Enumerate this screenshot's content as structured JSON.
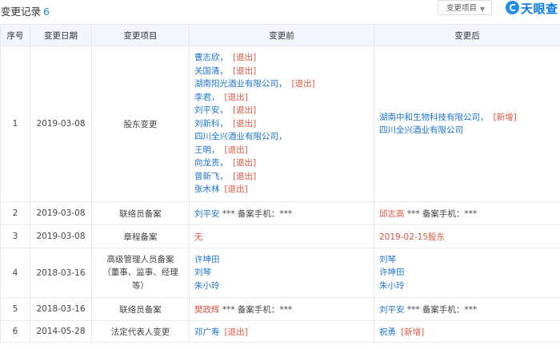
{
  "header": {
    "title": "变更记录",
    "count": "6",
    "filter_label": "变更项目",
    "filter_caret": "▼",
    "logo_text": "天眼查"
  },
  "columns": [
    "序号",
    "变更日期",
    "变更项目",
    "变更前",
    "变更后"
  ],
  "rows": [
    {
      "index": "1",
      "date": "2019-03-08",
      "item": "股东变更",
      "before": [
        {
          "text": "曹志欣，",
          "tag": "[退出]"
        },
        {
          "text": "关国清，",
          "tag": "[退出]"
        },
        {
          "text": "湖南阳光酒业有限公司，",
          "tag": "[退出]"
        },
        {
          "text": "李君，",
          "tag": "[退出]"
        },
        {
          "text": "刘平安，",
          "tag": "[退出]"
        },
        {
          "text": "刘新科，",
          "tag": "[退出]"
        },
        {
          "text": "四川全兴酒业有限公司，",
          "tag": ""
        },
        {
          "text": "王明，",
          "tag": "[退出]"
        },
        {
          "text": "向龙贵，",
          "tag": "[退出]"
        },
        {
          "text": "曾新飞，",
          "tag": "[退出]"
        },
        {
          "text": "张木林",
          "tag": "[退出]"
        }
      ],
      "after": [
        {
          "text": "湖南中和生物科技有限公司，",
          "tag": "[新增]"
        },
        {
          "text": "四川全兴酒业有限公司",
          "tag": ""
        }
      ]
    },
    {
      "index": "2",
      "date": "2019-03-08",
      "item": "联络员备案",
      "before_name": "刘平安",
      "before_rest": " *** 备案手机：***",
      "after_name": "邱志高",
      "after_rest": " *** 备案手机：***"
    },
    {
      "index": "3",
      "date": "2019-03-08",
      "item": "章程备案",
      "before_text": "无",
      "after_text": "2019-02-15股东"
    },
    {
      "index": "4",
      "date": "2018-03-16",
      "item_lines": [
        "高级管理人员备案",
        "（董事、监事、经理",
        "等）"
      ],
      "before": [
        "许坤田",
        "刘琴",
        "朱小玲"
      ],
      "after": [
        "刘琴",
        "许坤田",
        "朱小玲"
      ]
    },
    {
      "index": "5",
      "date": "2018-03-16",
      "item": "联络员备案",
      "before_name": "樊政辉",
      "before_rest": " *** 备案手机：***",
      "after_name": "刘平安",
      "after_rest": " *** 备案手机：***"
    },
    {
      "index": "6",
      "date": "2014-05-28",
      "item": "法定代表人变更",
      "before": {
        "text": "邓广寿",
        "tag": "[退出]"
      },
      "after": {
        "text": "祝勇",
        "tag": "[新增]"
      }
    }
  ]
}
